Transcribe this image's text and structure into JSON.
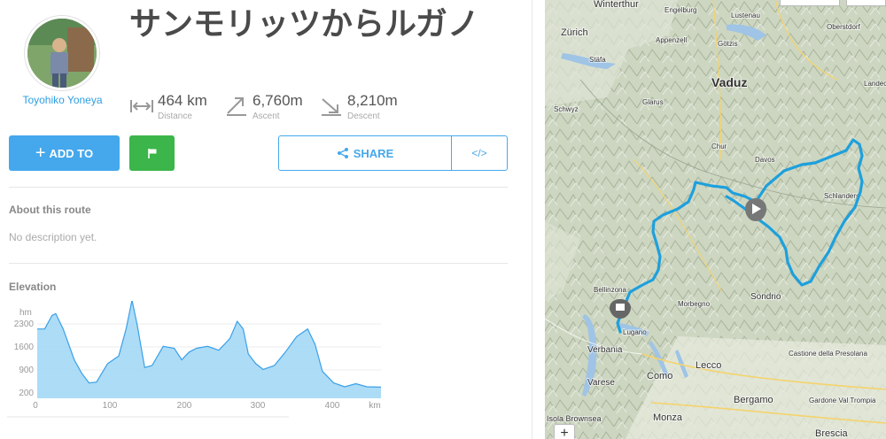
{
  "route": {
    "title": "サンモリッツからルガノ",
    "author": "Toyohiko Yoneya"
  },
  "stats": [
    {
      "value": "464 km",
      "label": "Distance",
      "icon": "distance-icon"
    },
    {
      "value": "6,760m",
      "label": "Ascent",
      "icon": "ascent-icon"
    },
    {
      "value": "8,210m",
      "label": "Descent",
      "icon": "descent-icon"
    }
  ],
  "actions": {
    "add_to": "ADD TO",
    "share": "SHARE",
    "embed": "</>"
  },
  "about": {
    "heading": "About this route",
    "description": "No description yet."
  },
  "elevation": {
    "heading": "Elevation"
  },
  "chart_data": {
    "type": "area",
    "ylabel": "hm",
    "xlabel": "km",
    "y_ticks": [
      "2300",
      "1600",
      "900",
      "200"
    ],
    "x_ticks": [
      "0",
      "100",
      "200",
      "300",
      "400",
      "km"
    ],
    "xlim": [
      0,
      464
    ],
    "ylim": [
      0,
      2300
    ],
    "x": [
      0,
      10,
      20,
      25,
      35,
      50,
      60,
      70,
      80,
      95,
      110,
      120,
      128,
      135,
      145,
      155,
      170,
      185,
      195,
      205,
      215,
      230,
      245,
      260,
      270,
      278,
      285,
      295,
      305,
      320,
      335,
      350,
      365,
      375,
      385,
      400,
      415,
      430,
      445,
      464
    ],
    "y": [
      1800,
      1800,
      2150,
      2200,
      1800,
      1000,
      650,
      400,
      420,
      900,
      1100,
      1800,
      2550,
      1900,
      800,
      850,
      1350,
      1300,
      1000,
      1200,
      1300,
      1350,
      1250,
      1550,
      2000,
      1800,
      1150,
      900,
      750,
      850,
      1200,
      1600,
      1800,
      1400,
      700,
      400,
      300,
      380,
      300,
      290
    ],
    "fill_color": "#9fd6f5",
    "line_color": "#3aa0e8"
  },
  "map": {
    "places": [
      {
        "name": "Winterthur"
      },
      {
        "name": "Zürich"
      },
      {
        "name": "Engelburg"
      },
      {
        "name": "Lustenau"
      },
      {
        "name": "Oberstdorf"
      },
      {
        "name": "Vaduz"
      },
      {
        "name": "Appenzell"
      },
      {
        "name": "Götzis"
      },
      {
        "name": "Stäfa"
      },
      {
        "name": "Schwyz"
      },
      {
        "name": "Glarus"
      },
      {
        "name": "Chur"
      },
      {
        "name": "Davos"
      },
      {
        "name": "Schlanders"
      },
      {
        "name": "Bellinzona"
      },
      {
        "name": "Lugano"
      },
      {
        "name": "Morbegno"
      },
      {
        "name": "Sondrio"
      },
      {
        "name": "Verbania"
      },
      {
        "name": "Varese"
      },
      {
        "name": "Como"
      },
      {
        "name": "Lecco"
      },
      {
        "name": "Bergamo"
      },
      {
        "name": "Monza"
      },
      {
        "name": "Brescia"
      },
      {
        "name": "Castione della Presolana"
      },
      {
        "name": "Gardone Val Trompia"
      },
      {
        "name": "Isola Brownsea"
      },
      {
        "name": "Landeck"
      }
    ],
    "zoom_in": "+",
    "colors": {
      "route": "#1ea0dc",
      "terrain": "#cfd8c4",
      "lake": "#9fc4e6"
    }
  }
}
